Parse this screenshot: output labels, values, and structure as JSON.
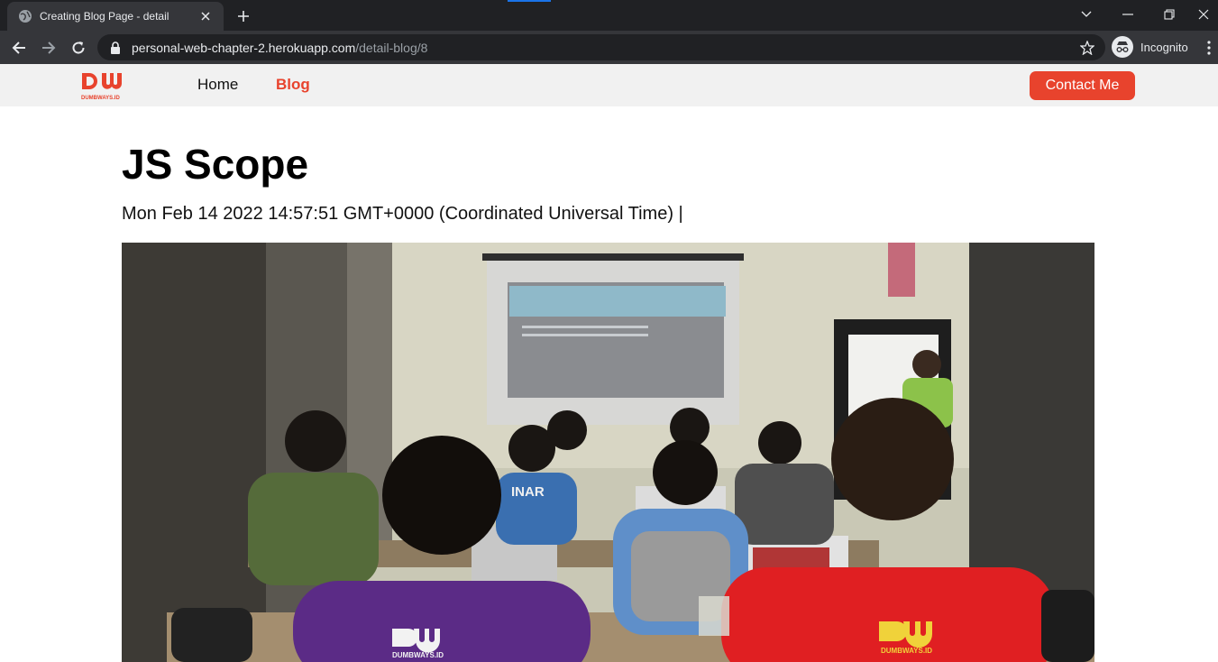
{
  "browser": {
    "tab_title": "Creating Blog Page - detail",
    "url_host": "personal-web-chapter-2.herokuapp.com",
    "url_path": "/detail-blog/8",
    "incognito_label": "Incognito"
  },
  "site": {
    "logo_text": "DUMBWAYS.ID",
    "nav": {
      "home_label": "Home",
      "blog_label": "Blog",
      "contact_label": "Contact Me"
    },
    "colors": {
      "accent": "#e8432d",
      "nav_bg": "#f1f1f1"
    }
  },
  "blog": {
    "title": "JS Scope",
    "date": "Mon Feb 14 2022 14:57:51 GMT+0000 (Coordinated Universal Time) |",
    "image": {
      "jersey_text": "INAR",
      "shirt_logo_text": "DUMBWAYS.ID"
    }
  }
}
